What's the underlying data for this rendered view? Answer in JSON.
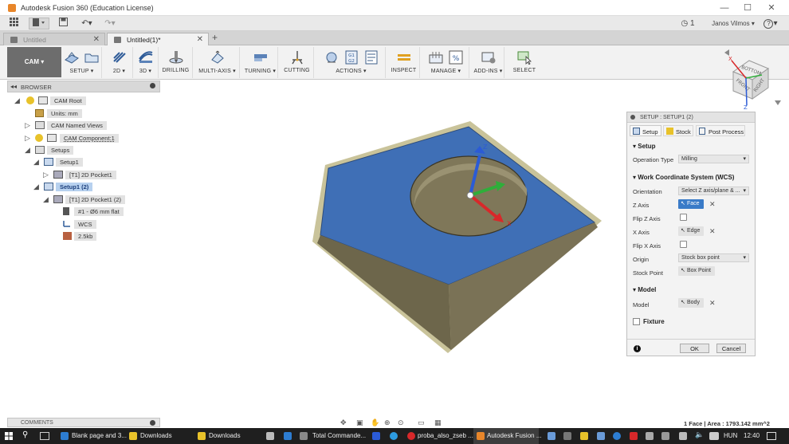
{
  "window": {
    "title": "Autodesk Fusion 360 (Education License)",
    "minimize": "—",
    "maximize": "☐",
    "close": "✕"
  },
  "quickbar": {
    "job_count": "1",
    "user": "Janos Vilmos",
    "help": "?"
  },
  "tabs": [
    {
      "label": "Untitled",
      "active": false
    },
    {
      "label": "Untitled(1)*",
      "active": true
    }
  ],
  "ribbon": {
    "workspace": "CAM ▾",
    "groups": [
      {
        "label": "SETUP ▾",
        "icon": "setup-icon"
      },
      {
        "label": "2D ▾",
        "icon": "2d-toolpath-icon"
      },
      {
        "label": "3D ▾",
        "icon": "3d-toolpath-icon"
      },
      {
        "label": "DRILLING",
        "icon": "drill-icon"
      },
      {
        "label": "MULTI-AXIS ▾",
        "icon": "multi-axis-icon"
      },
      {
        "label": "TURNING ▾",
        "icon": "turning-icon"
      },
      {
        "label": "CUTTING",
        "icon": "cutting-icon"
      },
      {
        "label": "ACTIONS ▾",
        "icon": "actions-icon"
      },
      {
        "label": "INSPECT",
        "icon": "inspect-icon"
      },
      {
        "label": "MANAGE ▾",
        "icon": "manage-icon"
      },
      {
        "label": "ADD-INS ▾",
        "icon": "add-ins-icon"
      },
      {
        "label": "SELECT",
        "icon": "select-icon"
      }
    ],
    "actions_g_label": "G1\nG2"
  },
  "browser": {
    "title": "BROWSER",
    "nodes": [
      {
        "label": "CAM Root"
      },
      {
        "label": "Units: mm"
      },
      {
        "label": "CAM Named Views"
      },
      {
        "label": "CAM Component:1"
      },
      {
        "label": "Setups"
      },
      {
        "label": "Setup1"
      },
      {
        "label": "[T1] 2D Pocket1"
      },
      {
        "label": "Setup1 (2)"
      },
      {
        "label": "[T1] 2D Pocket1 (2)"
      },
      {
        "label": "#1 - Ø6 mm flat"
      },
      {
        "label": "WCS"
      },
      {
        "label": "2.5kb"
      }
    ]
  },
  "viewcube": {
    "faces": [
      "FRONT",
      "RIGHT",
      "BOTTOM"
    ]
  },
  "setup_panel": {
    "title": "SETUP : SETUP1 (2)",
    "tabs": [
      "Setup",
      "Stock",
      "Post Process"
    ],
    "section_setup": "Setup",
    "operation_type_label": "Operation Type",
    "operation_type_value": "Milling",
    "section_wcs": "Work Coordinate System (WCS)",
    "orientation_label": "Orientation",
    "orientation_value": "Select Z axis/plane & ...",
    "z_axis_label": "Z Axis",
    "z_axis_value": "Face",
    "flip_z_label": "Flip Z Axis",
    "x_axis_label": "X Axis",
    "x_axis_value": "Edge",
    "flip_x_label": "Flip X Axis",
    "origin_label": "Origin",
    "origin_value": "Stock box point",
    "stock_point_label": "Stock Point",
    "stock_point_value": "Box Point",
    "section_model": "Model",
    "model_label": "Model",
    "model_value": "Body",
    "fixture_label": "Fixture",
    "ok": "OK",
    "cancel": "Cancel",
    "info": "i"
  },
  "comments": {
    "label": "COMMENTS"
  },
  "status": {
    "text": "1 Face | Area : 1793.142 mm^2"
  },
  "taskbar": {
    "items": [
      {
        "label": "Blank page and 3..."
      },
      {
        "label": "Downloads"
      },
      {
        "label": "Downloads"
      },
      {
        "label": "Total Commande..."
      },
      {
        "label": "proba_also_zseb ..."
      },
      {
        "label": "Autodesk Fusion ..."
      }
    ],
    "lang": "HUN",
    "time": "12:40"
  },
  "colors": {
    "face_blue": "#3f6fb6",
    "body_tan": "#7a7256",
    "accent_blue": "#3a7bc8"
  }
}
